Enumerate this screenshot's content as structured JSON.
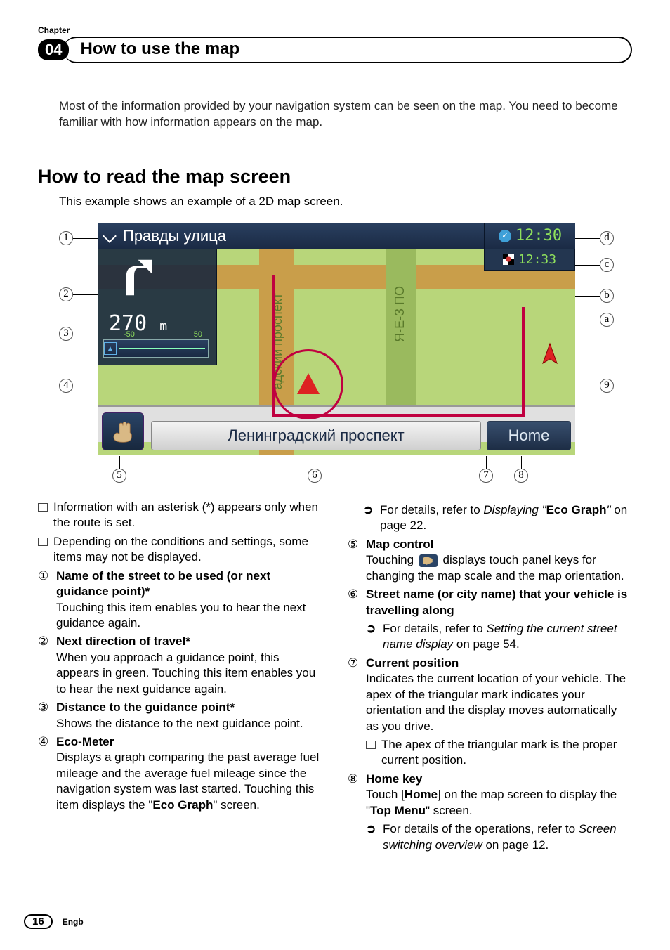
{
  "chapter_label": "Chapter",
  "chapter_number": "04",
  "header_title": "How to use the map",
  "intro": "Most of the information provided by your navigation system can be seen on the map. You need to become familiar with how information appears on the map.",
  "section_title": "How to read the map screen",
  "section_sub": "This example shows an example of a 2D map screen.",
  "map": {
    "top_street": "Правды улица",
    "clock1": "12:30",
    "clock2": "12:33",
    "guidance_distance": "270",
    "guidance_unit": "m",
    "eco_minus": "-50",
    "eco_plus": "50",
    "vertical_street": "адский проспект",
    "vertical_street2": "Я-Е-З  ПО",
    "bottom_street": "Ленинградский проспект",
    "home_label": "Home"
  },
  "callouts": {
    "c1": "1",
    "c2": "2",
    "c3": "3",
    "c4": "4",
    "c5": "5",
    "c6": "6",
    "c7": "7",
    "c8": "8",
    "c9": "9",
    "c10": "a",
    "c11": "b",
    "c12": "c",
    "c13": "d"
  },
  "left": {
    "note1": "Information with an asterisk (*) appears only when the route is set.",
    "note2": "Depending on the conditions and settings, some items may not be displayed.",
    "i1_num": "①",
    "i1_title": "Name of the street to be used (or next guidance point)*",
    "i1_body": "Touching this item enables you to hear the next guidance again.",
    "i2_num": "②",
    "i2_title": "Next direction of travel*",
    "i2_body": "When you approach a guidance point, this appears in green. Touching this item enables you to hear the next guidance again.",
    "i3_num": "③",
    "i3_title": "Distance to the guidance point*",
    "i3_body": "Shows the distance to the next guidance point.",
    "i4_num": "④",
    "i4_title": "Eco-Meter",
    "i4_body_a": "Displays a graph comparing the past average fuel mileage and the average fuel mileage since the navigation system was last started. Touching this item displays the \"",
    "i4_body_b": "Eco Graph",
    "i4_body_c": "\" screen."
  },
  "right": {
    "eco_a": "For details, refer to ",
    "eco_b": "Displaying \"",
    "eco_c": "Eco Graph",
    "eco_d": "\"",
    "eco_e": " on page 22.",
    "i5_num": "⑤",
    "i5_title": "Map control",
    "i5_body_a": "Touching ",
    "i5_body_b": " displays touch panel keys for changing the map scale and the map orientation.",
    "i6_num": "⑥",
    "i6_title": "Street name (or city name) that your vehicle is travelling along",
    "i6_sub_a": "For details, refer to ",
    "i6_sub_b": "Setting the current street name display",
    "i6_sub_c": " on page 54.",
    "i7_num": "⑦",
    "i7_title": "Current position",
    "i7_body": "Indicates the current location of your vehicle. The apex of the triangular mark indicates your orientation and the display moves automatically as you drive.",
    "i7_note": "The apex of the triangular mark is the proper current position.",
    "i8_num": "⑧",
    "i8_title": "Home key",
    "i8_body_a": "Touch [",
    "i8_body_b": "Home",
    "i8_body_c": "] on the map screen to display the \"",
    "i8_body_d": "Top Menu",
    "i8_body_e": "\" screen.",
    "i8_sub_a": "For details of the operations, refer to ",
    "i8_sub_b": "Screen switching overview",
    "i8_sub_c": " on page 12."
  },
  "footer": {
    "page": "16",
    "lang": "Engb"
  }
}
